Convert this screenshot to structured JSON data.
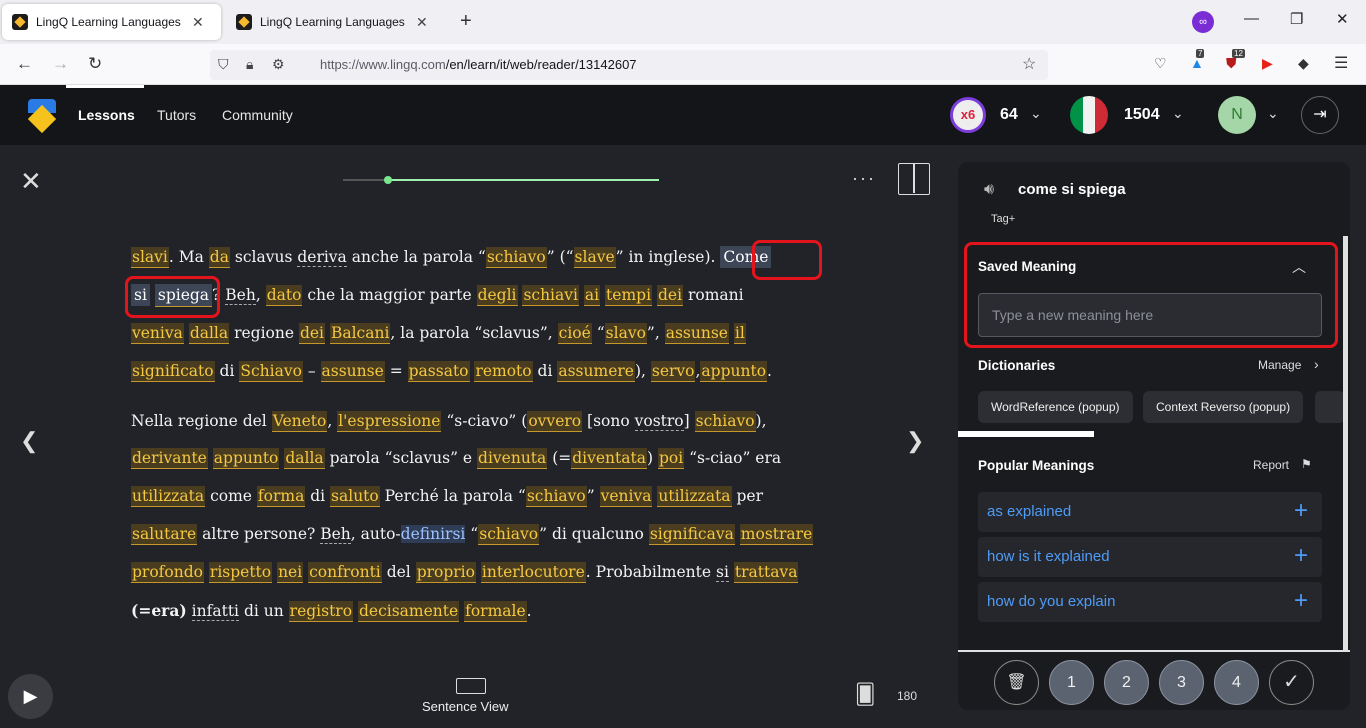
{
  "browser": {
    "tabs": [
      {
        "title": "LingQ Learning Languages Simp",
        "close": "✕"
      },
      {
        "title": "LingQ Learning Languages Simp",
        "close": "✕"
      }
    ],
    "new_tab": "+",
    "url_domain": "https://www.lingq.com",
    "url_path": "/en/learn/it/web/reader/13142607",
    "ext_badge_1": "7",
    "ext_badge_2": "12"
  },
  "app": {
    "nav": [
      "Lessons",
      "Tutors",
      "Community"
    ],
    "streak": "x6",
    "coins": "64",
    "known_words": "1504",
    "avatar_initial": "N"
  },
  "reader": {
    "sentence_view_label": "Sentence View",
    "cards_count": "180",
    "lines": [
      [
        {
          "t": "slavi",
          "c": "k"
        },
        {
          "t": ".  Ma "
        },
        {
          "t": "da",
          "c": "k"
        },
        {
          "t": " sclavus "
        },
        {
          "t": "deriva",
          "c": "s"
        },
        {
          "t": " anche la parola “"
        },
        {
          "t": "schiavo",
          "c": "k"
        },
        {
          "t": "” (“"
        },
        {
          "t": "slave",
          "c": "k"
        },
        {
          "t": "” in inglese). "
        },
        {
          "t": "Come",
          "c": "sel"
        }
      ],
      [
        {
          "t": "si",
          "c": "sel"
        },
        {
          "t": " "
        },
        {
          "t": "spiega",
          "c": "k sel2"
        },
        {
          "t": "?  "
        },
        {
          "t": "Beh",
          "c": "s"
        },
        {
          "t": ", "
        },
        {
          "t": "dato",
          "c": "k"
        },
        {
          "t": " che la maggior parte "
        },
        {
          "t": "degli",
          "c": "k"
        },
        {
          "t": " "
        },
        {
          "t": "schiavi",
          "c": "k"
        },
        {
          "t": " "
        },
        {
          "t": "ai",
          "c": "k"
        },
        {
          "t": " "
        },
        {
          "t": "tempi",
          "c": "k"
        },
        {
          "t": " "
        },
        {
          "t": "dei",
          "c": "k"
        },
        {
          "t": " romani"
        }
      ],
      [
        {
          "t": "veniva",
          "c": "k"
        },
        {
          "t": " "
        },
        {
          "t": "dalla",
          "c": "k"
        },
        {
          "t": " regione "
        },
        {
          "t": "dei",
          "c": "k"
        },
        {
          "t": " "
        },
        {
          "t": "Balcani",
          "c": "k"
        },
        {
          "t": ", la parola “sclavus”, "
        },
        {
          "t": "cioé",
          "c": "k"
        },
        {
          "t": " “"
        },
        {
          "t": "slavo",
          "c": "k"
        },
        {
          "t": "”, "
        },
        {
          "t": "assunse",
          "c": "k"
        },
        {
          "t": " "
        },
        {
          "t": "il",
          "c": "k"
        }
      ],
      [
        {
          "t": "significato",
          "c": "k"
        },
        {
          "t": " di "
        },
        {
          "t": "Schiavo",
          "c": "k"
        },
        {
          "t": " – "
        },
        {
          "t": "assunse",
          "c": "k"
        },
        {
          "t": " = "
        },
        {
          "t": "passato",
          "c": "k"
        },
        {
          "t": " "
        },
        {
          "t": "remoto",
          "c": "k"
        },
        {
          "t": " di "
        },
        {
          "t": "assumere",
          "c": "k"
        },
        {
          "t": "), "
        },
        {
          "t": "servo",
          "c": "k"
        },
        {
          "t": ","
        },
        {
          "t": "appunto",
          "c": "k"
        },
        {
          "t": "."
        }
      ],
      [
        {
          "t": "Nella regione del "
        },
        {
          "t": "Veneto",
          "c": "k"
        },
        {
          "t": ", "
        },
        {
          "t": "l'espressione",
          "c": "k"
        },
        {
          "t": " “s-ciavo” ("
        },
        {
          "t": "ovvero",
          "c": "k"
        },
        {
          "t": " [sono "
        },
        {
          "t": "vostro",
          "c": "s"
        },
        {
          "t": "] "
        },
        {
          "t": "schiavo",
          "c": "k"
        },
        {
          "t": "),"
        }
      ],
      [
        {
          "t": "derivante",
          "c": "k"
        },
        {
          "t": " "
        },
        {
          "t": "appunto",
          "c": "k"
        },
        {
          "t": " "
        },
        {
          "t": "dalla",
          "c": "k"
        },
        {
          "t": " parola “sclavus” e "
        },
        {
          "t": "divenuta",
          "c": "k"
        },
        {
          "t": " (="
        },
        {
          "t": "diventata",
          "c": "k"
        },
        {
          "t": ") "
        },
        {
          "t": "poi",
          "c": "k"
        },
        {
          "t": " “s-ciao” era"
        }
      ],
      [
        {
          "t": "utilizzata",
          "c": "k"
        },
        {
          "t": " come "
        },
        {
          "t": "forma",
          "c": "k"
        },
        {
          "t": " di "
        },
        {
          "t": "saluto",
          "c": "k"
        },
        {
          "t": " Perché la parola “"
        },
        {
          "t": "schiavo",
          "c": "k"
        },
        {
          "t": "” "
        },
        {
          "t": "veniva",
          "c": "k"
        },
        {
          "t": " "
        },
        {
          "t": "utilizzata",
          "c": "k"
        },
        {
          "t": " per"
        }
      ],
      [
        {
          "t": "salutare",
          "c": "k"
        },
        {
          "t": " altre persone? "
        },
        {
          "t": "Beh",
          "c": "s"
        },
        {
          "t": ", auto-"
        },
        {
          "t": "definirsi",
          "c": "blue"
        },
        {
          "t": " “"
        },
        {
          "t": "schiavo",
          "c": "k"
        },
        {
          "t": "” di qualcuno "
        },
        {
          "t": "significava",
          "c": "k"
        },
        {
          "t": " "
        },
        {
          "t": "mostrare",
          "c": "k"
        }
      ],
      [
        {
          "t": "profondo",
          "c": "k"
        },
        {
          "t": " "
        },
        {
          "t": "rispetto",
          "c": "k"
        },
        {
          "t": " "
        },
        {
          "t": "nei",
          "c": "k"
        },
        {
          "t": " "
        },
        {
          "t": "confronti",
          "c": "k"
        },
        {
          "t": " del "
        },
        {
          "t": "proprio",
          "c": "k"
        },
        {
          "t": " "
        },
        {
          "t": "interlocutore",
          "c": "k"
        },
        {
          "t": ".  Probabilmente "
        },
        {
          "t": "si",
          "c": "s"
        },
        {
          "t": " "
        },
        {
          "t": "trattava",
          "c": "k"
        }
      ],
      [
        {
          "t": "(=era)",
          "c": "b"
        },
        {
          "t": " "
        },
        {
          "t": "infatti",
          "c": "s"
        },
        {
          "t": " di un "
        },
        {
          "t": "registro",
          "c": "k"
        },
        {
          "t": " "
        },
        {
          "t": "decisamente",
          "c": "k"
        },
        {
          "t": " "
        },
        {
          "t": "formale",
          "c": "k"
        },
        {
          "t": "."
        }
      ]
    ]
  },
  "panel": {
    "term": "come si spiega",
    "tag": "Tag+",
    "saved_meaning_title": "Saved Meaning",
    "meaning_placeholder": "Type a new meaning here",
    "dictionaries_title": "Dictionaries",
    "manage": "Manage",
    "dictionaries": [
      "WordReference (popup)",
      "Context Reverso (popup)"
    ],
    "popular_title": "Popular Meanings",
    "report": "Report",
    "popular_meanings": [
      "as explained",
      "how is it explained",
      "how do you explain"
    ],
    "status": [
      "1",
      "2",
      "3",
      "4"
    ]
  },
  "colors": {
    "known_highlight": "#f5c842",
    "link_blue": "#4f9cf7",
    "annotation_red": "#e4141c",
    "panel_bg": "#1a1b1e",
    "page_bg": "#212328"
  }
}
